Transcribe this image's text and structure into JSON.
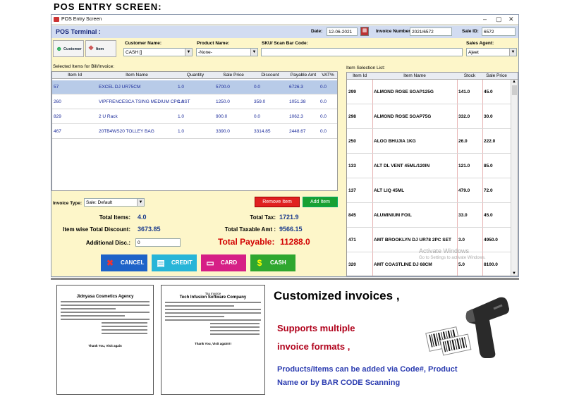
{
  "heading": "POS ENTRY SCREEN:",
  "window": {
    "title": "POS Entry Screen"
  },
  "header": {
    "terminal_label": "POS Terminal :",
    "date_label": "Date:",
    "date_value": "12-06-2021",
    "invoice_label": "Invoice Number:",
    "invoice_value": "2021/6572",
    "sale_id_label": "Sale ID:",
    "sale_id_value": "6572"
  },
  "toolbar": {
    "customer_btn": "Customer",
    "item_btn": "Item",
    "customer_name_label": "Customer Name:",
    "customer_name_value": "CASH []",
    "product_name_label": "Product Name:",
    "product_name_value": "-None-",
    "sku_label": "SKU/ Scan Bar Code:",
    "sku_value": "",
    "sales_agent_label": "Sales Agent:",
    "sales_agent_value": "Ajeet"
  },
  "bill": {
    "title": "Selected Items for Bill/Invoice:",
    "columns": [
      "Item Id",
      "Item Name",
      "Quantity",
      "Sale Price",
      "Discount",
      "Payable Amt",
      "VAT%"
    ],
    "rows": [
      [
        "57",
        "EXCEL DJ UR75CM",
        "1.0",
        "5700.0",
        "0.0",
        "6726.3",
        "0.0"
      ],
      [
        "260",
        "VIPFRENCESCA TSING MEDIUM CPC AST",
        "1.0",
        "1250.0",
        "359.0",
        "1051.38",
        "0.0"
      ],
      [
        "829",
        "2 U Rack",
        "1.0",
        "900.0",
        "0.0",
        "1062.3",
        "0.0"
      ],
      [
        "467",
        "20TB4WS20 TOLLEY BAG",
        "1.0",
        "3390.0",
        "3314.85",
        "2448.67",
        "0.0"
      ]
    ]
  },
  "selection": {
    "title": "Item Selection List:",
    "columns": [
      "Item Id",
      "Item Name",
      "Stock",
      "Sale Price"
    ],
    "rows": [
      [
        "299",
        "ALMOND ROSE SOAP125G",
        "141.0",
        "45.0"
      ],
      [
        "298",
        "ALMOND ROSE SOAP75G",
        "332.0",
        "30.0"
      ],
      [
        "250",
        "ALOO BHUJIA 1KG",
        "26.0",
        "222.0"
      ],
      [
        "133",
        "ALT DL VENT 45ML/120IN",
        "121.0",
        "85.0"
      ],
      [
        "137",
        "ALT LIQ 45ML",
        "479.0",
        "72.0"
      ],
      [
        "845",
        "ALUMINIUM FOIL",
        "33.0",
        "45.0"
      ],
      [
        "471",
        "AMT BROOKLYN DJ UR78 2PC SET",
        "3.0",
        "4950.0"
      ],
      [
        "320",
        "AMT COASTLINE DJ 68CM",
        "5.0",
        "8100.0"
      ]
    ],
    "watermark1": "Activate Windows",
    "watermark2": "Go to Settings to activate Windows."
  },
  "invoice_type": {
    "label": "Invoice Type:",
    "value": "Sale: Default"
  },
  "actions": {
    "remove": "Remove Item",
    "add": "Add Item"
  },
  "summary": {
    "total_items_label": "Total Items:",
    "total_items": "4.0",
    "total_tax_label": "Total Tax:",
    "total_tax": "1721.9",
    "item_discount_label": "Item wise Total Discount:",
    "item_discount": "3673.85",
    "taxable_label": "Total Taxable Amt :",
    "taxable": "9566.15",
    "additional_label": "Additional Disc.:",
    "additional": "0",
    "payable_label": "Total Payable:",
    "payable": "11288.0"
  },
  "pay": {
    "cancel": "CANCEL",
    "credit": "CREDIT",
    "card": "CARD",
    "cash": "CASH"
  },
  "promo": {
    "line1": "Customized invoices ,",
    "line2": "Supports multiple",
    "line3": "invoice formats ,",
    "line4": "Products/Items can be added via Code#, Product",
    "line5": "Name or by BAR CODE Scanning"
  },
  "invoice1": {
    "company": "Jidnyasa Cosmetics Agency",
    "footer": "Thank You, Visit again"
  },
  "invoice2": {
    "type": "Tax Invoice",
    "company": "Tech Infusion Software Company",
    "footer": "Thank You, Visit again!!!"
  },
  "colors": {
    "accent": "#1b3b8c",
    "payable": "#d20000",
    "promo": "#b0001a",
    "promo_blue": "#2a3bb0"
  }
}
